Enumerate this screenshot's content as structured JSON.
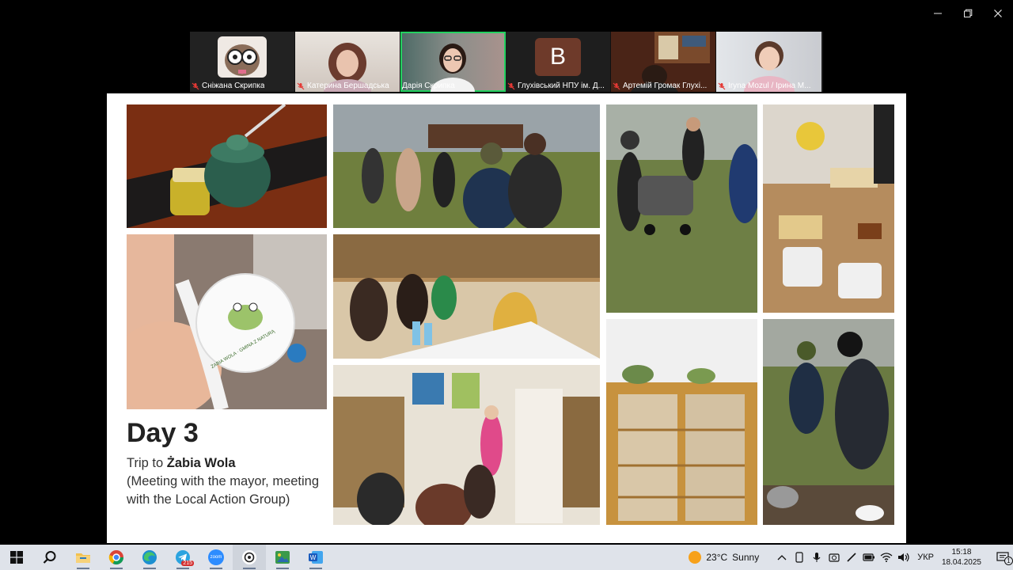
{
  "window": {
    "minimize_label": "Minimize",
    "maximize_label": "Restore",
    "close_label": "Close"
  },
  "participants": [
    {
      "name": "Сніжана Скрипка",
      "muted": true,
      "active": false,
      "avatar": "owl-cartoon"
    },
    {
      "name": "Катерина Бершадська",
      "muted": true,
      "active": false,
      "avatar": "video"
    },
    {
      "name": "Дарія Скрипка",
      "muted": false,
      "active": true,
      "avatar": "video"
    },
    {
      "name": "Глухівський НПУ ім. Д...",
      "muted": true,
      "active": false,
      "avatar": "initial",
      "initial": "B"
    },
    {
      "name": "Артемій Громак Глухі...",
      "muted": true,
      "active": false,
      "avatar": "video"
    },
    {
      "name": "Iryna Mozul / Ірина М...",
      "muted": true,
      "active": false,
      "avatar": "video"
    }
  ],
  "slide": {
    "title": "Day 3",
    "trip_prefix": "Trip to ",
    "trip_place": "Żabia Wola",
    "trip_details": "(Meeting with the mayor, meeting with the Local Action Group)",
    "badge_text": "ŻABIA WOLA · GMINA Z NATURĄ"
  },
  "taskbar": {
    "apps": [
      "windows-start",
      "search",
      "file-explorer",
      "chrome",
      "edge",
      "telegram",
      "zoom",
      "chatgpt",
      "gallery",
      "word"
    ],
    "telegram_badge": "215",
    "zoom_label": "zoom",
    "weather_temp": "23°C",
    "weather_text": "Sunny",
    "language": "УКР",
    "time": "15:18",
    "date": "18.04.2025",
    "notification_count": "1"
  },
  "colors": {
    "accent_active": "#23d160",
    "muted_red": "#e53935",
    "taskbar_bg": "#dfe3ea",
    "avatar_b": "#6e3a2a"
  }
}
